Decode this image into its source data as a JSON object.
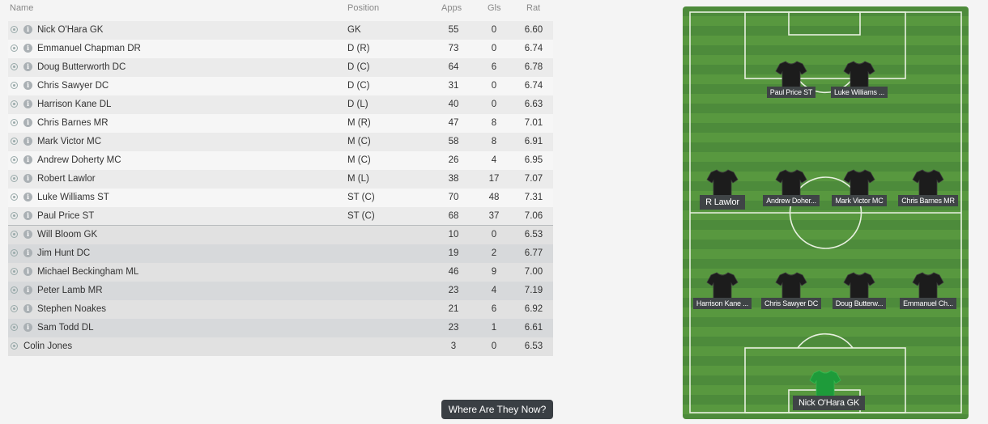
{
  "table": {
    "headers": {
      "name": "Name",
      "position": "Position",
      "apps": "Apps",
      "gls": "Gls",
      "rat": "Rat"
    },
    "rows": [
      {
        "name": "Nick O'Hara GK",
        "position": "GK",
        "apps": "55",
        "gls": "0",
        "rat": "6.60"
      },
      {
        "name": "Emmanuel Chapman DR",
        "position": "D (R)",
        "apps": "73",
        "gls": "0",
        "rat": "6.74"
      },
      {
        "name": "Doug Butterworth DC",
        "position": "D (C)",
        "apps": "64",
        "gls": "6",
        "rat": "6.78"
      },
      {
        "name": "Chris Sawyer DC",
        "position": "D (C)",
        "apps": "31",
        "gls": "0",
        "rat": "6.74"
      },
      {
        "name": "Harrison Kane DL",
        "position": "D (L)",
        "apps": "40",
        "gls": "0",
        "rat": "6.63"
      },
      {
        "name": "Chris Barnes MR",
        "position": "M (R)",
        "apps": "47",
        "gls": "8",
        "rat": "7.01"
      },
      {
        "name": "Mark Victor MC",
        "position": "M (C)",
        "apps": "58",
        "gls": "8",
        "rat": "6.91"
      },
      {
        "name": "Andrew Doherty MC",
        "position": "M (C)",
        "apps": "26",
        "gls": "4",
        "rat": "6.95"
      },
      {
        "name": "Robert Lawlor",
        "position": "M (L)",
        "apps": "38",
        "gls": "17",
        "rat": "7.07"
      },
      {
        "name": "Luke Williams ST",
        "position": "ST (C)",
        "apps": "70",
        "gls": "48",
        "rat": "7.31"
      },
      {
        "name": "Paul Price ST",
        "position": "ST (C)",
        "apps": "68",
        "gls": "37",
        "rat": "7.06"
      },
      {
        "name": "Will Bloom GK",
        "position": "",
        "apps": "10",
        "gls": "0",
        "rat": "6.53"
      },
      {
        "name": "Jim Hunt DC",
        "position": "",
        "apps": "19",
        "gls": "2",
        "rat": "6.77"
      },
      {
        "name": "Michael Beckingham ML",
        "position": "",
        "apps": "46",
        "gls": "9",
        "rat": "7.00"
      },
      {
        "name": "Peter Lamb MR",
        "position": "",
        "apps": "23",
        "gls": "4",
        "rat": "7.19"
      },
      {
        "name": "Stephen Noakes",
        "position": "",
        "apps": "21",
        "gls": "6",
        "rat": "6.92"
      },
      {
        "name": "Sam Todd DL",
        "position": "",
        "apps": "23",
        "gls": "1",
        "rat": "6.61"
      },
      {
        "name": "Colin Jones",
        "position": "",
        "apps": "3",
        "gls": "0",
        "rat": "6.53"
      }
    ]
  },
  "button": {
    "label": "Where Are They Now?"
  },
  "pitch": {
    "players": [
      {
        "label": "Paul Price ST",
        "kit": "black"
      },
      {
        "label": "Luke Williams ...",
        "kit": "black"
      },
      {
        "label": "R Lawlor",
        "kit": "black"
      },
      {
        "label": "Andrew Doher...",
        "kit": "black"
      },
      {
        "label": "Mark Victor MC",
        "kit": "black"
      },
      {
        "label": "Chris Barnes MR",
        "kit": "black"
      },
      {
        "label": "Harrison Kane ...",
        "kit": "black"
      },
      {
        "label": "Chris Sawyer DC",
        "kit": "black"
      },
      {
        "label": "Doug Butterw...",
        "kit": "black"
      },
      {
        "label": "Emmanuel Ch...",
        "kit": "black"
      },
      {
        "label": "Nick O'Hara GK",
        "kit": "green"
      }
    ]
  },
  "colors": {
    "outfield_kit": "#1c1c1c",
    "gk_kit": "#1e9b3a",
    "pitch": "#4f8d3c",
    "button": "#3a3f44"
  }
}
